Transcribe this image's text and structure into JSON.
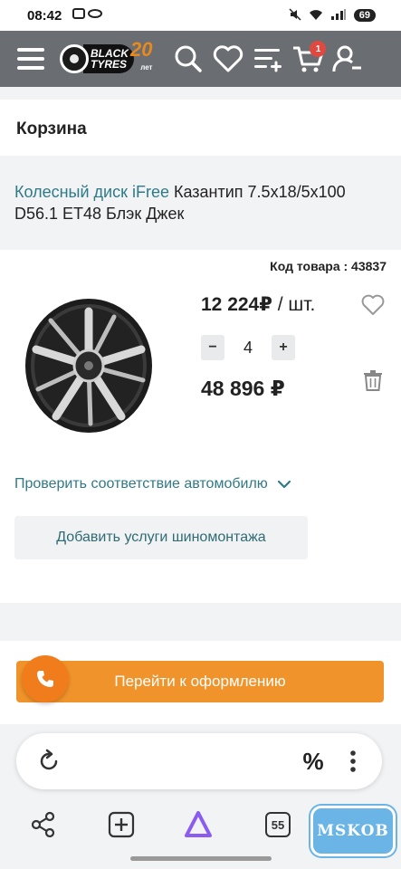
{
  "status_bar": {
    "time": "08:42",
    "battery": "69"
  },
  "header": {
    "logo_line1": "BLACK",
    "logo_line2": "TYRES",
    "logo_badge": "20",
    "logo_badge_small": "лет",
    "cart_count": "1",
    "icons": [
      "menu-icon",
      "search-icon",
      "heart-icon",
      "compare-icon",
      "cart-icon",
      "profile-icon"
    ]
  },
  "page": {
    "title": "Корзина"
  },
  "product": {
    "link_text": "Колесный диск iFree",
    "name_rest": " Казантип 7.5x18/5x100 D56.1 ET48 Блэк Джек",
    "code_label": "Код товара : 43837",
    "price": "12 224",
    "currency": "₽",
    "unit": " / шт.",
    "quantity": "4",
    "minus": "−",
    "plus": "+",
    "total": "48 896 ₽",
    "check_fit": "Проверить соответствие автомобилю",
    "service_button": "Добавить услуги шиномонтажа"
  },
  "checkout": {
    "button_label": "Перейти к оформлению"
  },
  "browser": {
    "percent": "%",
    "tabs_count": "55"
  },
  "watermark": "MSKOB",
  "colors": {
    "accent": "#f0932a",
    "link": "#2f7a86",
    "header": "#6a6d72",
    "badge": "#e0493f"
  }
}
